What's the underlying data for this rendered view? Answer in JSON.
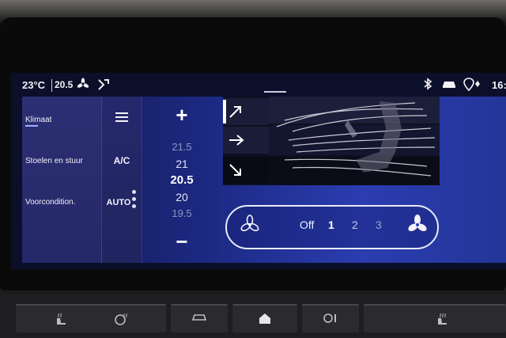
{
  "status_bar": {
    "outside_temp": "23°C",
    "set_temp": "20.5",
    "time": "16:"
  },
  "sidebar": {
    "items": [
      {
        "label": "Klimaat",
        "active": true
      },
      {
        "label": "Stoelen en stuur",
        "active": false
      },
      {
        "label": "Voorcondition.",
        "active": false
      }
    ]
  },
  "controls": {
    "menu_icon": "menu-icon",
    "ac_label": "A/C",
    "auto_label": "AUTO"
  },
  "temperature": {
    "plus_label": "+",
    "minus_label": "−",
    "values": [
      "21.5",
      "21",
      "20.5",
      "20",
      "19.5"
    ],
    "selected": "20.5"
  },
  "air_direction": {
    "options": [
      "up-right-arrow-icon",
      "right-arrow-icon",
      "down-right-arrow-icon"
    ],
    "active_index": 2
  },
  "fan": {
    "levels": [
      "Off",
      "1",
      "2",
      "3"
    ],
    "selected": "1"
  },
  "colors": {
    "screen_accent": "#2b3db0",
    "sidebar_bg": "#2c2f73",
    "text": "#f2f2f5"
  }
}
